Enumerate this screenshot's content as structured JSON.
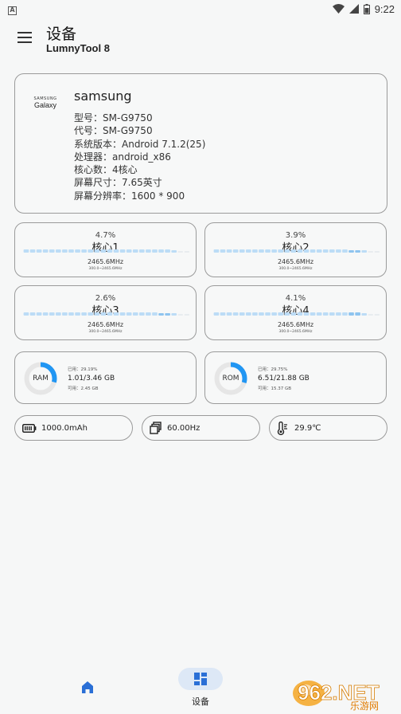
{
  "status_bar": {
    "app_icon_letter": "A",
    "time": "9:22"
  },
  "header": {
    "title": "设备",
    "subtitle": "LumnyTool 8"
  },
  "device": {
    "logo_top": "SAMSUNG",
    "logo_bottom": "Galaxy",
    "name": "samsung",
    "specs": [
      "型号：SM-G9750",
      "代号：SM-G9750",
      "系统版本：Android 7.1.2(25)",
      "处理器：android_x86",
      "核心数：4核心",
      "屏幕尺寸：7.65英寸",
      "屏幕分辨率：1600 * 900"
    ]
  },
  "cores": [
    {
      "percent": "4.7%",
      "name": "核心1",
      "freq": "2465.6MHz",
      "range": "300.0~2465.6MHz",
      "history": [
        5,
        5,
        5,
        5,
        5,
        5,
        5,
        5,
        5,
        5,
        5,
        5,
        5,
        5,
        5,
        5,
        5,
        5,
        5,
        5,
        5,
        4.7,
        4.7,
        2,
        0,
        0
      ]
    },
    {
      "percent": "3.9%",
      "name": "核心2",
      "freq": "2465.6MHz",
      "range": "300.0~2465.6MHz",
      "history": [
        5,
        5,
        5,
        5,
        5,
        5,
        5,
        5,
        5,
        5,
        5,
        5,
        5,
        5,
        5,
        5,
        5,
        5,
        5,
        5,
        5,
        3.9,
        3.9,
        2,
        0,
        0
      ]
    },
    {
      "percent": "2.6%",
      "name": "核心3",
      "freq": "2465.6MHz",
      "range": "300.0~2465.6MHz",
      "history": [
        5,
        5,
        5,
        5,
        5,
        5,
        5,
        5,
        5,
        5,
        5,
        5,
        5,
        5,
        5,
        5,
        5,
        5,
        5,
        5,
        5,
        2.6,
        2.6,
        2,
        0,
        0
      ]
    },
    {
      "percent": "4.1%",
      "name": "核心4",
      "freq": "2465.6MHz",
      "range": "300.0~2465.6MHz",
      "history": [
        5,
        5,
        5,
        5,
        5,
        5,
        5,
        5,
        5,
        5,
        5,
        5,
        5,
        5,
        5,
        5,
        5,
        5,
        5,
        5,
        5,
        4.1,
        4.1,
        2,
        0,
        0
      ]
    }
  ],
  "memory": [
    {
      "label": "RAM",
      "used": "已用：29.19%",
      "total": "1.01/3.46 GB",
      "avail": "可用：2.45 GB",
      "fraction": 0.2919
    },
    {
      "label": "ROM",
      "used": "已用：29.75%",
      "total": "6.51/21.88 GB",
      "avail": "可用：15.37 GB",
      "fraction": 0.2975
    }
  ],
  "pills": {
    "battery": "1000.0mAh",
    "refresh": "60.00Hz",
    "temperature": "29.9℃"
  },
  "nav": {
    "device_label": "设备"
  },
  "watermark": {
    "brand": "962.NET",
    "sub": "乐游网"
  },
  "colors": {
    "accent": "#2196f3",
    "bar_light": "#bcdcf6",
    "ring_track": "#e6e6e6"
  }
}
